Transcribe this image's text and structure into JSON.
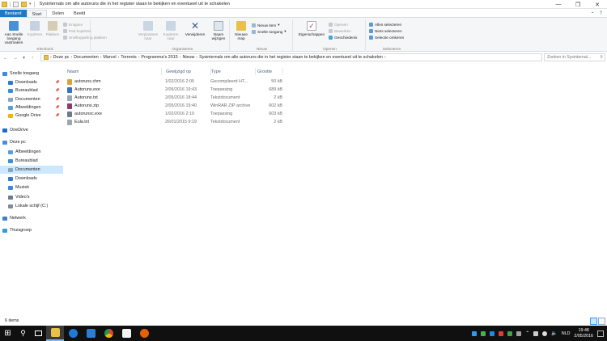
{
  "window": {
    "title": "Sysinternals om alle autoruns die in het register staan te bekijken en eventueel uit te schakelen",
    "minimize": "—",
    "maximize": "❐",
    "close": "✕"
  },
  "tabs": [
    "Bestand",
    "Start",
    "Delen",
    "Beeld"
  ],
  "ribbon": {
    "pin_quick_access": "Aan Snelle toegang vastmaken",
    "copy": "Kopiëren",
    "paste": "Plakken",
    "cut": "Knippen",
    "copy_path": "Pad kopiëren",
    "paste_shortcut": "Snelkoppeling plakken",
    "group_clipboard": "Klembord",
    "move_to": "Verplaatsen naar",
    "copy_to": "Kopiëren naar",
    "delete": "Verwijderen",
    "rename": "Naam wijzigen",
    "group_organize": "Organiseren",
    "new_folder": "Nieuwe map",
    "new_item": "Nieuw item",
    "easy_access": "Snelle toegang",
    "group_new": "Nieuw",
    "properties": "Eigenschappen",
    "open": "Openen",
    "edit": "Bewerken",
    "history": "Geschiedenis",
    "group_open": "Openen",
    "select_all": "Alles selecteren",
    "select_none": "Niets selecteren",
    "invert_selection": "Selectie omkeren",
    "group_select": "Selecteren"
  },
  "address": {
    "crumbs": [
      "Deze pc",
      "Documenten",
      "Marcel",
      "Torrents",
      "Programma's 2015",
      "Nieuw",
      "Sysinternals om alle autoruns die in het register staan te bekijken en eventueel uit te schakelen"
    ],
    "search_placeholder": "Zoeken in Sysinternal..."
  },
  "nav": [
    {
      "label": "Snelle toegang",
      "icon": "star-icon",
      "color": "#3c8de0",
      "indent": 0,
      "pin": false
    },
    {
      "label": "Downloads",
      "icon": "download-icon",
      "color": "#2b7cd3",
      "indent": 1,
      "pin": true
    },
    {
      "label": "Bureaublad",
      "icon": "desktop-icon",
      "color": "#3b8ed8",
      "indent": 1,
      "pin": true
    },
    {
      "label": "Documenten",
      "icon": "documents-icon",
      "color": "#8aa4bd",
      "indent": 1,
      "pin": true
    },
    {
      "label": "Afbeeldingen",
      "icon": "pictures-icon",
      "color": "#5aa0d6",
      "indent": 1,
      "pin": true
    },
    {
      "label": "Google Drive",
      "icon": "google-drive-icon",
      "color": "#f4b400",
      "indent": 1,
      "pin": true
    },
    {
      "label": "OneDrive",
      "icon": "onedrive-icon",
      "color": "#1c6bd0",
      "indent": 0,
      "pin": false
    },
    {
      "label": "Deze pc",
      "icon": "computer-icon",
      "color": "#4a90d9",
      "indent": 0,
      "pin": false
    },
    {
      "label": "Afbeeldingen",
      "icon": "pictures-icon",
      "color": "#5aa0d6",
      "indent": 1,
      "pin": false
    },
    {
      "label": "Bureaublad",
      "icon": "desktop-icon",
      "color": "#3b8ed8",
      "indent": 1,
      "pin": false
    },
    {
      "label": "Documenten",
      "icon": "documents-icon",
      "color": "#8aa4bd",
      "indent": 1,
      "pin": false,
      "selected": true
    },
    {
      "label": "Downloads",
      "icon": "download-icon",
      "color": "#2b7cd3",
      "indent": 1,
      "pin": false
    },
    {
      "label": "Muziek",
      "icon": "music-icon",
      "color": "#3d8ad8",
      "indent": 1,
      "pin": false
    },
    {
      "label": "Video's",
      "icon": "video-icon",
      "color": "#6b7c8c",
      "indent": 1,
      "pin": false
    },
    {
      "label": "Lokale schijf (C:)",
      "icon": "disk-icon",
      "color": "#7f8c99",
      "indent": 1,
      "pin": false
    },
    {
      "label": "Netwerk",
      "icon": "network-icon",
      "color": "#3e7fc7",
      "indent": 0,
      "pin": false
    },
    {
      "label": "Thuisgroep",
      "icon": "homegroup-icon",
      "color": "#2c9fd9",
      "indent": 0,
      "pin": false
    }
  ],
  "columns": [
    "Naam",
    "Gewijzigd op",
    "Type",
    "Grootte"
  ],
  "files": [
    {
      "name": "autoruns.chm",
      "date": "1/02/2016 2:05",
      "type": "Gecompileerd HT...",
      "size": "50 kB",
      "icon": "help-file-icon",
      "color": "#d8a33c"
    },
    {
      "name": "Autoruns.exe",
      "date": "2/05/2016 19:43",
      "type": "Toepassing",
      "size": "689 kB",
      "icon": "app-icon",
      "color": "#3a6fc4"
    },
    {
      "name": "Autoruns.txt",
      "date": "2/05/2016 18:44",
      "type": "Tekstdocument",
      "size": "2 kB",
      "icon": "text-file-icon",
      "color": "#9aa7b5"
    },
    {
      "name": "Autoruns.zip",
      "date": "2/05/2016 19:40",
      "type": "WinRAR ZIP archive",
      "size": "602 kB",
      "icon": "zip-icon",
      "color": "#8b3b6f"
    },
    {
      "name": "autorunsc.exe",
      "date": "1/02/2016 2:10",
      "type": "Toepassing",
      "size": "603 kB",
      "icon": "app-icon",
      "color": "#6b7b8c"
    },
    {
      "name": "Eula.txt",
      "date": "26/01/2015 9:19",
      "type": "Tekstdocument",
      "size": "2 kB",
      "icon": "text-file-icon",
      "color": "#9aa7b5"
    }
  ],
  "status": {
    "count": "6 items"
  },
  "tray": {
    "language": "NLD",
    "time": "19:48",
    "date": "2/05/2016"
  }
}
